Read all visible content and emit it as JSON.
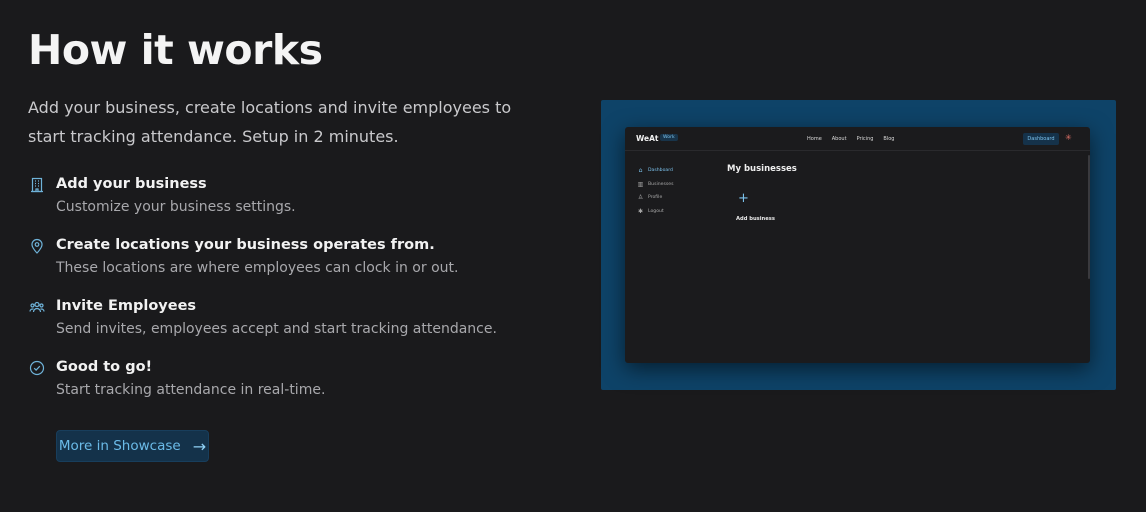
{
  "title": "How it works",
  "lead": "Add your business, create locations and invite employees to start tracking attendance. Setup in 2 minutes.",
  "steps": [
    {
      "icon": "building-icon",
      "title": "Add your business",
      "desc": "Customize your business settings."
    },
    {
      "icon": "location-pin-icon",
      "title": "Create locations your business operates from.",
      "desc": "These locations are where employees can clock in or out."
    },
    {
      "icon": "users-icon",
      "title": "Invite Employees",
      "desc": "Send invites, employees accept and start tracking attendance."
    },
    {
      "icon": "check-circle-icon",
      "title": "Good to go!",
      "desc": "Start tracking attendance in real-time."
    }
  ],
  "cta": {
    "label": "More in Showcase",
    "icon": "arrow-right-icon"
  },
  "preview": {
    "logo": "WeAt",
    "tag": "Work",
    "nav_links": [
      "Home",
      "About",
      "Pricing",
      "Blog"
    ],
    "dashboard_button": "Dashboard",
    "theme_icon": "sun-icon",
    "sidebar": [
      {
        "label": "Dashboard",
        "icon": "home-icon"
      },
      {
        "label": "Businesses",
        "icon": "building-icon"
      },
      {
        "label": "Profile",
        "icon": "user-icon"
      },
      {
        "label": "Logout",
        "icon": "logout-icon"
      }
    ],
    "heading": "My businesses",
    "add_label": "Add business",
    "add_icon": "plus-icon"
  },
  "colors": {
    "background": "#1a1a1c",
    "accent": "#6bbbe8",
    "preview_bg": "#0e4368"
  }
}
